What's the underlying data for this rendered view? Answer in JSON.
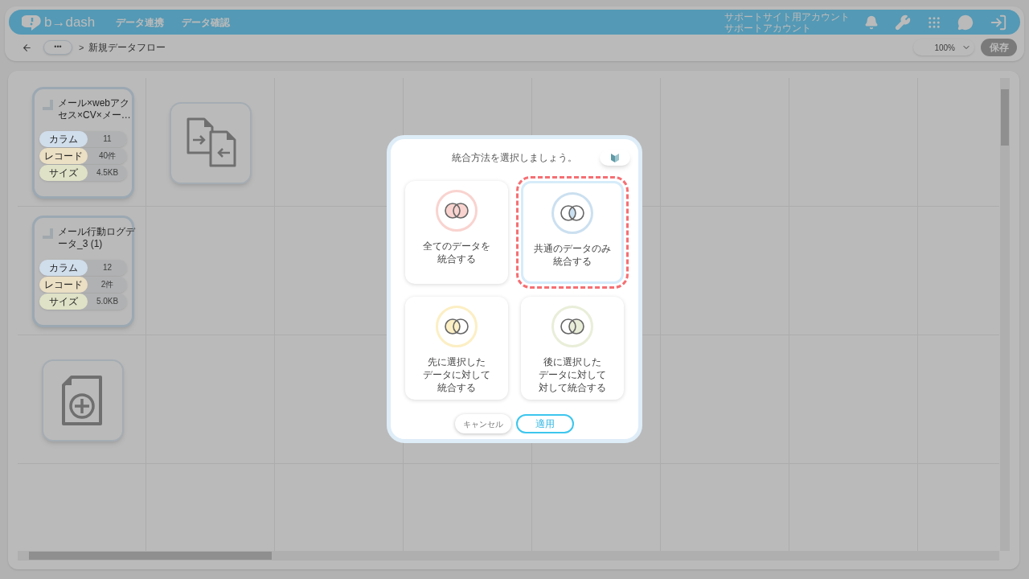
{
  "header": {
    "logo": "b→dash",
    "nav": [
      "データ連携",
      "データ確認"
    ],
    "account": [
      "サポートサイト用アカウント",
      "サポートアカウント"
    ]
  },
  "toolbar": {
    "more": "•••",
    "separator": ">",
    "breadcrumb": "新規データフロー",
    "zoom": "100%",
    "save": {
      "label": "保存",
      "disabled": true
    }
  },
  "nodes": [
    {
      "kind": "data",
      "title": "メール×webアクセス×CV×メー…",
      "stats": [
        {
          "label": "カラム",
          "value": "11",
          "color": "#d0ddeb"
        },
        {
          "label": "レコード",
          "value": "40件",
          "color": "#ebdfc4"
        },
        {
          "label": "サイズ",
          "value": "4.5KB",
          "color": "#dfe2c6"
        }
      ]
    },
    {
      "kind": "data",
      "title": "メール行動ログデータ_3 (1)",
      "stats": [
        {
          "label": "カラム",
          "value": "12",
          "color": "#d0ddeb"
        },
        {
          "label": "レコード",
          "value": "2件",
          "color": "#ebdfc4"
        },
        {
          "label": "サイズ",
          "value": "5.0KB",
          "color": "#dfe2c6"
        }
      ]
    },
    {
      "kind": "merge"
    },
    {
      "kind": "add"
    }
  ],
  "modal": {
    "title": "統合方法を選択しましょう。",
    "options": [
      {
        "kind": "all",
        "lines": [
          "全てのデータを",
          "統合する"
        ],
        "color": "#f9d3cf",
        "selected": false
      },
      {
        "kind": "inner",
        "lines": [
          "共通のデータのみ",
          "統合する"
        ],
        "color": "#cbe0f0",
        "selected": true
      },
      {
        "kind": "left",
        "lines": [
          "先に選択した",
          "データに対して",
          "統合する"
        ],
        "color": "#fcefc4",
        "selected": false
      },
      {
        "kind": "right",
        "lines": [
          "後に選択した",
          "データに対して",
          "対して統合する"
        ],
        "color": "#e9eed9",
        "selected": false
      }
    ],
    "cancel": "キャンセル",
    "apply": "適用"
  }
}
